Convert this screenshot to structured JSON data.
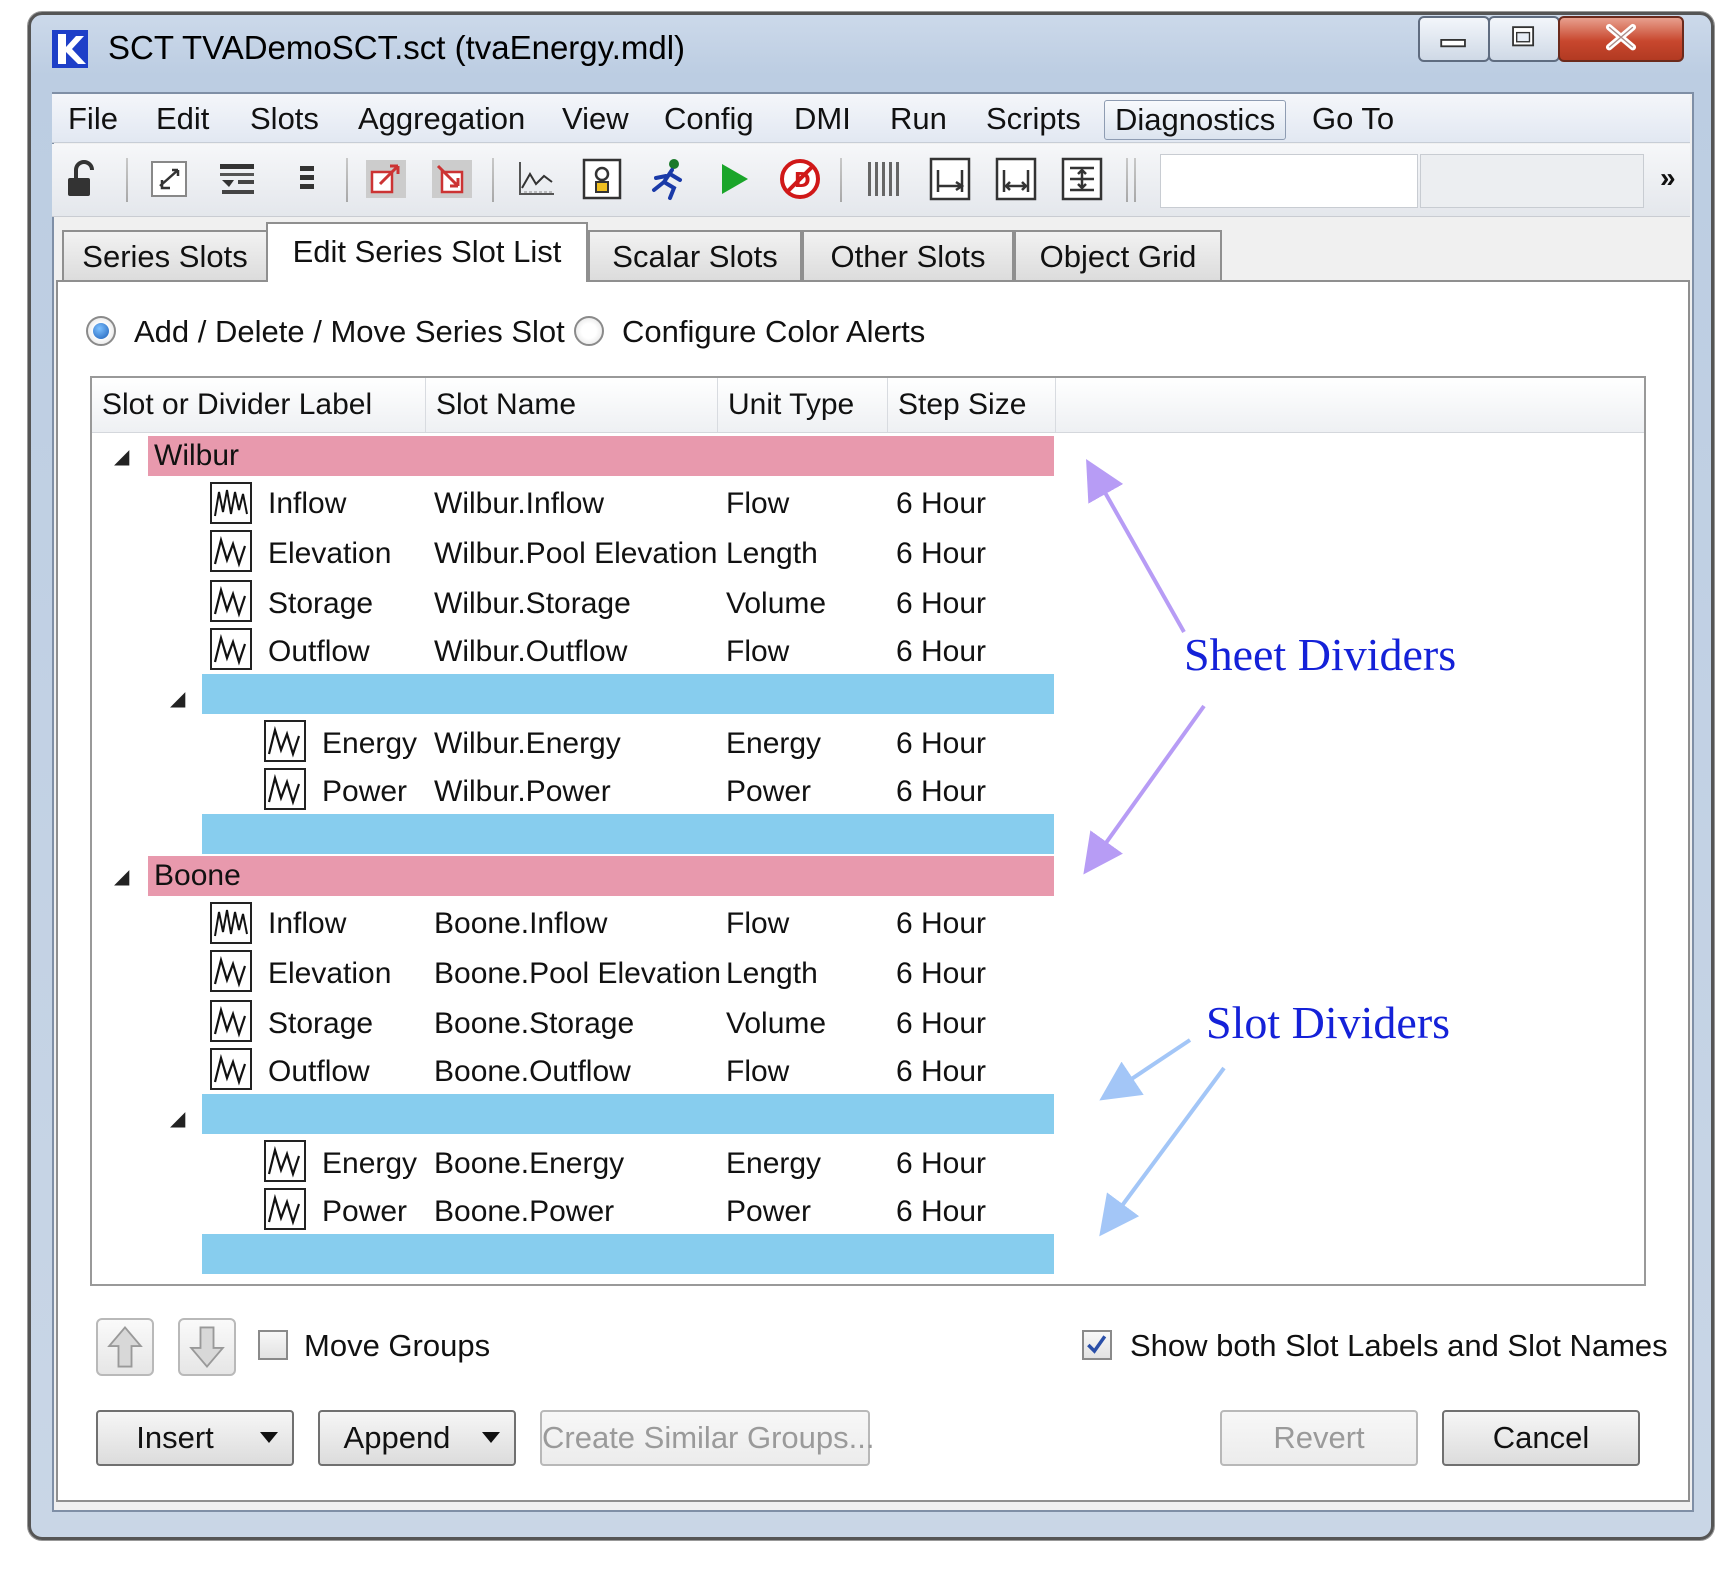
{
  "window": {
    "title": "SCT TVADemoSCT.sct (tvaEnergy.mdl)",
    "controls": {
      "minimize": "minimize-icon",
      "maximize": "maximize-icon",
      "close": "close-icon"
    }
  },
  "menu": [
    "File",
    "Edit",
    "Slots",
    "Aggregation",
    "View",
    "Config",
    "DMI",
    "Run",
    "Scripts",
    "Diagnostics",
    "Go To"
  ],
  "toolbar": {
    "more": "»",
    "icons": [
      "lock-icon",
      "swap-icon",
      "table-filter-icon",
      "list-icon",
      "export-icon",
      "import-icon",
      "plot-icon",
      "open-object-icon",
      "run-man-icon",
      "play-icon",
      "stop-icon",
      "columns-icon",
      "fit-width-icon",
      "resize-width-icon",
      "fit-all-icon"
    ]
  },
  "tabs": [
    "Series Slots",
    "Edit Series Slot List",
    "Scalar Slots",
    "Other Slots",
    "Object Grid"
  ],
  "mode": {
    "option1": "Add / Delete / Move Series Slot",
    "option2": "Configure Color Alerts",
    "selected": "Add / Delete / Move Series Slot"
  },
  "table": {
    "headers": [
      "Slot or Divider Label",
      "Slot Name",
      "Unit Type",
      "Step Size"
    ],
    "groups": [
      {
        "label": "Wilbur",
        "rows": [
          {
            "label": "Inflow",
            "name": "Wilbur.Inflow",
            "unit": "Flow",
            "step": "6 Hour"
          },
          {
            "label": "Elevation",
            "name": "Wilbur.Pool Elevation",
            "unit": "Length",
            "step": "6 Hour"
          },
          {
            "label": "Storage",
            "name": "Wilbur.Storage",
            "unit": "Volume",
            "step": "6 Hour"
          },
          {
            "label": "Outflow",
            "name": "Wilbur.Outflow",
            "unit": "Flow",
            "step": "6 Hour"
          }
        ],
        "subrows": [
          {
            "label": "Energy",
            "name": "Wilbur.Energy",
            "unit": "Energy",
            "step": "6 Hour"
          },
          {
            "label": "Power",
            "name": "Wilbur.Power",
            "unit": "Power",
            "step": "6 Hour"
          }
        ]
      },
      {
        "label": "Boone",
        "rows": [
          {
            "label": "Inflow",
            "name": "Boone.Inflow",
            "unit": "Flow",
            "step": "6 Hour"
          },
          {
            "label": "Elevation",
            "name": "Boone.Pool Elevation",
            "unit": "Length",
            "step": "6 Hour"
          },
          {
            "label": "Storage",
            "name": "Boone.Storage",
            "unit": "Volume",
            "step": "6 Hour"
          },
          {
            "label": "Outflow",
            "name": "Boone.Outflow",
            "unit": "Flow",
            "step": "6 Hour"
          }
        ],
        "subrows": [
          {
            "label": "Energy",
            "name": "Boone.Energy",
            "unit": "Energy",
            "step": "6 Hour"
          },
          {
            "label": "Power",
            "name": "Boone.Power",
            "unit": "Power",
            "step": "6 Hour"
          }
        ]
      }
    ]
  },
  "annotations": {
    "sheet": "Sheet Dividers",
    "slot": "Slot Dividers"
  },
  "colors": {
    "sheet_divider": "#e899ad",
    "slot_divider": "#87cdee",
    "sheet_arrow": "#b79cf5",
    "slot_arrow": "#a3c6f7",
    "annotation_text": "#1421d8"
  },
  "bottom": {
    "move_groups": "Move Groups",
    "move_groups_checked": false,
    "show_both": "Show both Slot Labels and Slot Names",
    "show_both_checked": true,
    "buttons": {
      "insert": "Insert",
      "append": "Append",
      "create_similar": "Create Similar Groups...",
      "revert": "Revert",
      "cancel": "Cancel"
    }
  }
}
